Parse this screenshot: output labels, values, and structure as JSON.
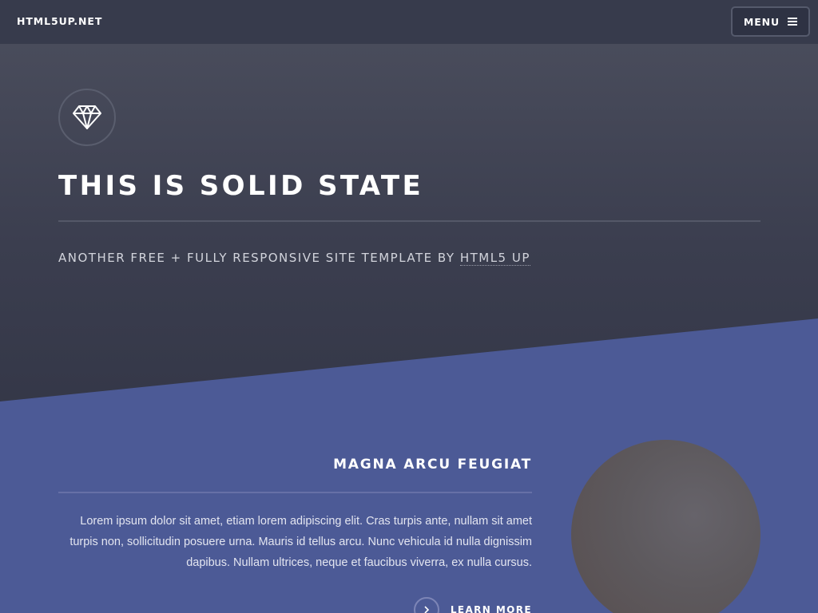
{
  "header": {
    "logo": "HTML5UP.NET",
    "menu_label": "MENU",
    "menu_icon": "hamburger-menu-icon"
  },
  "banner": {
    "icon": "diamond-icon",
    "title": "THIS IS SOLID STATE",
    "subtitle_prefix": "ANOTHER FREE + FULLY RESPONSIVE SITE TEMPLATE BY ",
    "subtitle_link": "HTML5 UP"
  },
  "feature": {
    "title": "MAGNA ARCU FEUGIAT",
    "text": "Lorem ipsum dolor sit amet, etiam lorem adipiscing elit. Cras turpis ante, nullam sit amet turpis non, sollicitudin posuere urna. Mauris id tellus arcu. Nunc vehicula id nulla dignissim dapibus. Nullam ultrices, neque et faucibus viverra, ex nulla cursus.",
    "link_label": "LEARN MORE",
    "link_icon": "chevron-right-icon",
    "image": "circular-photo"
  },
  "colors": {
    "header_bg": "#373b4c",
    "banner_top": "#4c4f5e",
    "banner_bottom": "#2c2f3f",
    "accent_blue": "#4c5c96",
    "text_white": "#ffffff"
  }
}
